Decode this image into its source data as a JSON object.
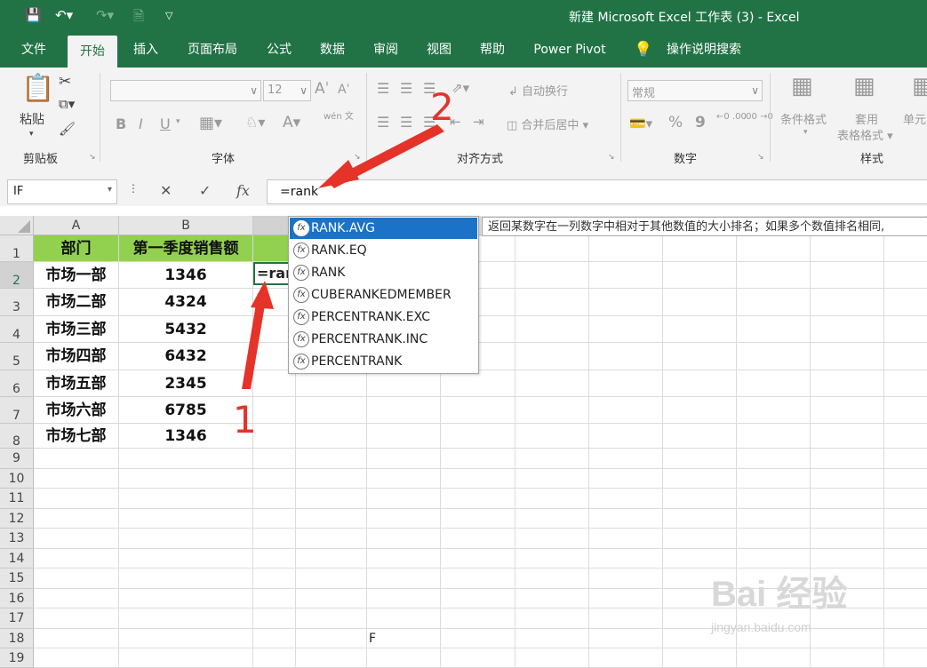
{
  "window": {
    "title": "新建 Microsoft Excel 工作表 (3)  -  Excel"
  },
  "ribbon_tabs": [
    "文件",
    "开始",
    "插入",
    "页面布局",
    "公式",
    "数据",
    "审阅",
    "视图",
    "帮助",
    "Power Pivot",
    "操作说明搜索"
  ],
  "active_tab": "开始",
  "ribbon": {
    "clipboard": {
      "paste": "粘贴",
      "label": "剪贴板"
    },
    "font": {
      "size": "12",
      "label": "字体",
      "bold": "B",
      "italic": "I",
      "underline": "U",
      "grow": "A",
      "shrink": "A",
      "font_color": "A",
      "phonetic": "wén 文"
    },
    "alignment": {
      "wrap": "自动换行",
      "merge": "合并后居中",
      "label": "对齐方式"
    },
    "number": {
      "format": "常规",
      "percent": "%",
      "comma": "9",
      "inc_dec": "←0 .00",
      "dec_dec": ".00 →0",
      "label": "数字"
    },
    "styles": {
      "conditional": "条件格式",
      "table": "套用",
      "table2": "表格格式",
      "cell": "单元",
      "label": "样式"
    }
  },
  "formula_bar": {
    "name_box": "IF",
    "fx_label": "fx",
    "formula": "=rank"
  },
  "sheet": {
    "columns": [
      "A",
      "B"
    ],
    "rows": [
      "1",
      "2",
      "3",
      "4",
      "5",
      "6",
      "7",
      "8",
      "9",
      "10",
      "11",
      "12",
      "13",
      "14",
      "15",
      "16",
      "17",
      "18",
      "19"
    ],
    "header_row": [
      "部门",
      "第一季度销售额"
    ],
    "data": [
      [
        "市场一部",
        "1346"
      ],
      [
        "市场二部",
        "4324"
      ],
      [
        "市场三部",
        "5432"
      ],
      [
        "市场四部",
        "6432"
      ],
      [
        "市场五部",
        "2345"
      ],
      [
        "市场六部",
        "6785"
      ],
      [
        "市场七部",
        "1346"
      ]
    ],
    "editing_cell_text": "=ran",
    "stray_text": "F"
  },
  "autocomplete": {
    "items": [
      "RANK.AVG",
      "RANK.EQ",
      "RANK",
      "CUBERANKEDMEMBER",
      "PERCENTRANK.EXC",
      "PERCENTRANK.INC",
      "PERCENTRANK"
    ],
    "selected_index": 0,
    "tooltip": "返回某数字在一列数字中相对于其他数值的大小排名；如果多个数值排名相同,"
  },
  "annotations": {
    "one": "1",
    "two": "2"
  },
  "watermark": {
    "brand": "Bai 经验",
    "url": "jingyan.baidu.com"
  },
  "colors": {
    "excel_green": "#217346",
    "header_fill": "#92d050",
    "arrow_red": "#e5332a",
    "selected_blue": "#1a73c8"
  }
}
